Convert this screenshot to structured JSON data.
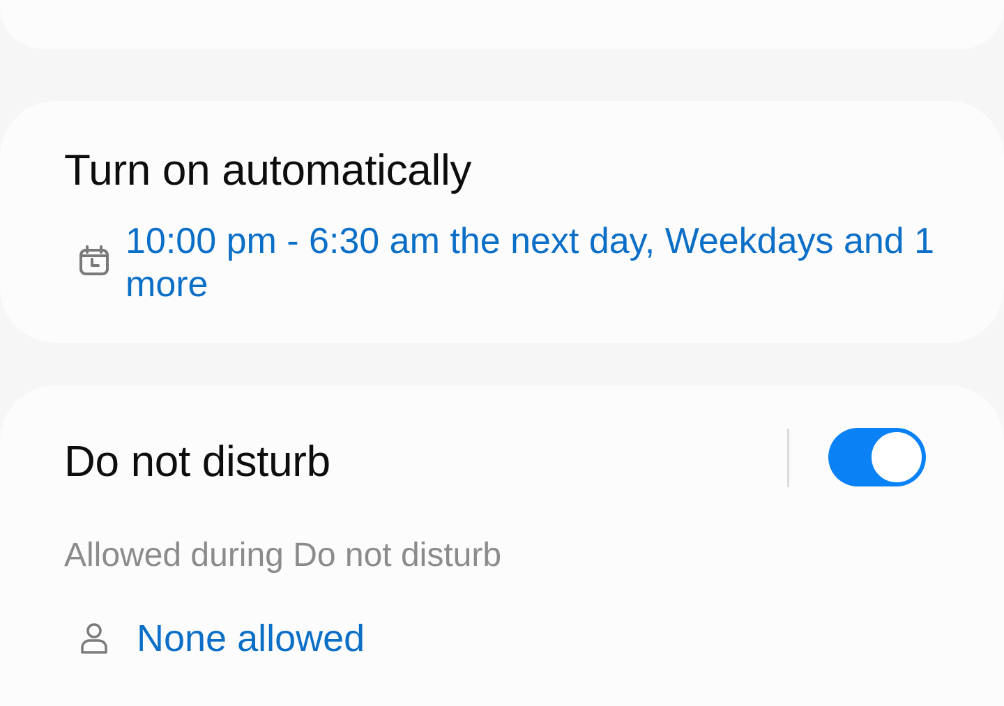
{
  "auto_section": {
    "title": "Turn on automatically",
    "schedule_icon": "calendar-clock-icon",
    "schedule_text": "10:00 pm - 6:30 am the next day, Weekdays and 1 more"
  },
  "dnd_section": {
    "title": "Do not disturb",
    "toggle_on": true,
    "allowed_label": "Allowed during Do not disturb",
    "people_icon": "person-icon",
    "people_value": "None allowed"
  },
  "colors": {
    "accent": "#0a82f5",
    "link": "#0c6fc7",
    "background": "#f6f6f6",
    "card": "#fcfcfc",
    "secondary_text": "#8b8b8b"
  }
}
